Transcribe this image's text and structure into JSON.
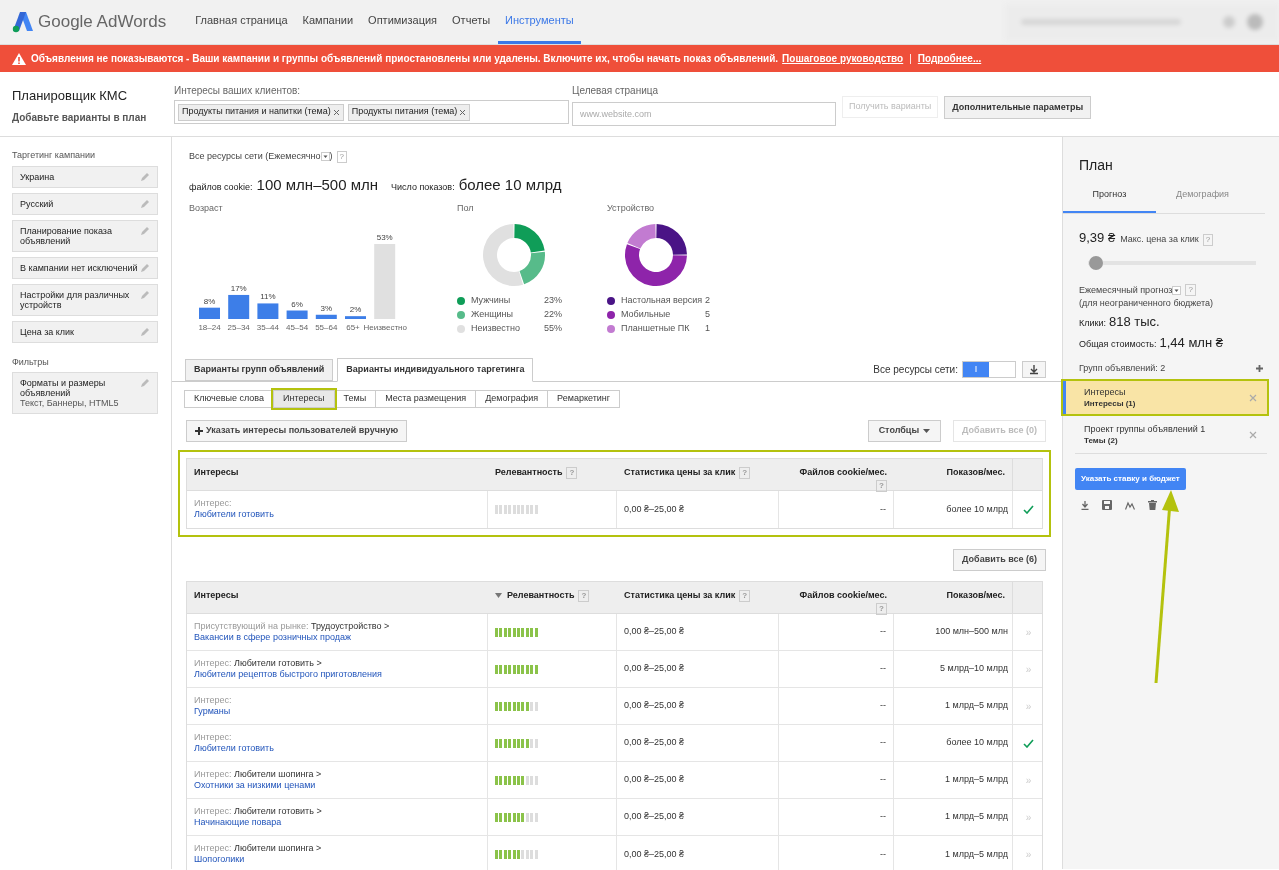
{
  "header": {
    "logo_text": "Google AdWords",
    "nav": [
      {
        "label": "Главная страница",
        "selected": false
      },
      {
        "label": "Кампании",
        "selected": false
      },
      {
        "label": "Оптимизация",
        "selected": false
      },
      {
        "label": "Отчеты",
        "selected": false
      },
      {
        "label": "Инструменты",
        "selected": true
      }
    ]
  },
  "banner": {
    "message": "Объявления не показываются - Ваши кампании и группы объявлений приостановлены или удалены. Включите их, чтобы начать показ объявлений.",
    "links": [
      "Пошаговое руководство",
      "Подробнее..."
    ],
    "separator": "|"
  },
  "planner": {
    "title": "Планировщик КМС",
    "subtitle": "Добавьте варианты в план"
  },
  "interests_input": {
    "label": "Интересы ваших клиентов:",
    "chips": [
      "Продукты питания и напитки (тема)",
      "Продукты питания (тема)"
    ]
  },
  "landing_page": {
    "label": "Целевая страница",
    "placeholder": "www.website.com"
  },
  "get_ideas_button": {
    "label": "Получить варианты",
    "disabled": true
  },
  "advanced_button": {
    "label": "Дополнительные параметры",
    "disabled": false
  },
  "sidebar": {
    "targeting_title": "Таргетинг кампании",
    "targeting_items": [
      {
        "title": "Украина"
      },
      {
        "title": "Русский"
      },
      {
        "title": "Планирование показа объявлений"
      },
      {
        "title": "В кампании нет исключений"
      },
      {
        "title": "Настройки для различных устройств"
      },
      {
        "title": "Цена за клик"
      }
    ],
    "filters_title": "Фильтры",
    "filter_items": [
      {
        "title": "Форматы и размеры объявлений",
        "detail": "Текст, Баннеры, HTML5"
      }
    ]
  },
  "summary": {
    "network": "Все ресурсы сети (Ежемесячно",
    "network_end": ")",
    "help": "?",
    "cookies_label": "файлов cookie:",
    "cookies_value": "100 млн–500 млн",
    "impressions_label": "Число показов:",
    "impressions_value": "более 10 млрд"
  },
  "age": {
    "title": "Возраст",
    "chart_data": {
      "type": "bar",
      "categories": [
        "18–24",
        "25–34",
        "35–44",
        "45–54",
        "55–64",
        "65+",
        "Неизвестно"
      ],
      "values": [
        8,
        17,
        11,
        6,
        3,
        2,
        53
      ],
      "colors": [
        "#3d7ee8",
        "#3d7ee8",
        "#3d7ee8",
        "#3d7ee8",
        "#3d7ee8",
        "#3d7ee8",
        "#e0e0e0"
      ],
      "data_labels": true,
      "value_labels": [
        "8%",
        "17%",
        "11%",
        "6%",
        "3%",
        "2%",
        "53%"
      ]
    }
  },
  "gender": {
    "title": "Пол",
    "chart_data": {
      "type": "donut",
      "values": [
        23,
        22,
        55
      ]
    },
    "legend": [
      {
        "label": "Мужчины",
        "value": "23%",
        "color": "#0f9d58"
      },
      {
        "label": "Женщины",
        "value": "22%",
        "color": "#57bb8a"
      },
      {
        "label": "Неизвестно",
        "value": "55%",
        "color": "#e0e0e0"
      }
    ]
  },
  "device": {
    "title": "Устройство",
    "legend": [
      {
        "label": "Настольная версия",
        "value": "2",
        "color": "#4a1486"
      },
      {
        "label": "Мобильные",
        "value": "5",
        "color": "#8e24aa"
      },
      {
        "label": "Планшетные ПК",
        "value": "1",
        "color": "#c27bd1"
      }
    ]
  },
  "idea_tabs": [
    {
      "label": "Варианты групп объявлений",
      "selected": false
    },
    {
      "label": "Варианты индивидуального таргетинга",
      "selected": true
    }
  ],
  "network_toggle": {
    "label": "Все ресурсы сети:",
    "on": true,
    "on_glyph": "I"
  },
  "subtabs": [
    {
      "label": "Ключевые слова",
      "selected": false,
      "highlighted": false
    },
    {
      "label": "Интересы",
      "selected": true,
      "highlighted": true
    },
    {
      "label": "Темы",
      "selected": false,
      "highlighted": false
    },
    {
      "label": "Места размещения",
      "selected": false,
      "highlighted": false
    },
    {
      "label": "Демография",
      "selected": false,
      "highlighted": false
    },
    {
      "label": "Ремаркетинг",
      "selected": false,
      "highlighted": false
    }
  ],
  "manual_button": "Указать интересы пользователей вручную",
  "columns_button": "Столбцы",
  "add_all_top": {
    "label": "Добавить все (0)",
    "disabled": true
  },
  "selected_table": {
    "highlighted": true,
    "columns": [
      {
        "label": "Интересы",
        "sorted": false
      },
      {
        "label": "Релевантность",
        "help": "?",
        "sorted": false
      },
      {
        "label": "Статистика цены за клик",
        "help": "?",
        "sorted": false
      },
      {
        "label": "Файлов cookie/мес.",
        "help": "?",
        "sorted": false
      },
      {
        "label": "Показов/мес.",
        "sorted": false
      }
    ],
    "rows": [
      {
        "prefix": "Интерес:",
        "name": "Любители готовить",
        "level": 0,
        "cpc": "0,00 ₴–25,00 ₴",
        "cookies": "--",
        "impressions": "более 10 млрд",
        "added": true
      }
    ]
  },
  "add_all_bottom": {
    "label": "Добавить все (6)",
    "disabled": false
  },
  "ideas_table": {
    "columns": [
      {
        "label": "Интересы",
        "sorted": false
      },
      {
        "label": "Релевантность",
        "help": "?",
        "sorted": true
      },
      {
        "label": "Статистика цены за клик",
        "help": "?",
        "sorted": false
      },
      {
        "label": "Файлов cookie/мес.",
        "help": "?",
        "sorted": false
      },
      {
        "label": "Показов/мес.",
        "sorted": false
      }
    ],
    "rows": [
      {
        "prefix": "Присутствующий на рынке:",
        "path": "Трудоустройство >",
        "name": "Вакансии в сфере розничных продаж",
        "level": 1,
        "cpc": "0,00 ₴–25,00 ₴",
        "cookies": "--",
        "impressions": "100 млн–500 млн",
        "added": false,
        "add_glyph": "»"
      },
      {
        "prefix": "Интерес:",
        "path": "Любители готовить >",
        "name": "Любители рецептов быстрого приготовления",
        "level": 1,
        "cpc": "0,00 ₴–25,00 ₴",
        "cookies": "--",
        "impressions": "5 млрд–10 млрд",
        "added": false,
        "add_glyph": "»"
      },
      {
        "prefix": "Интерес:",
        "name": "Гурманы",
        "level": 0.8,
        "cpc": "0,00 ₴–25,00 ₴",
        "cookies": "--",
        "impressions": "1 млрд–5 млрд",
        "added": false,
        "add_glyph": "»"
      },
      {
        "prefix": "Интерес:",
        "name": "Любители готовить",
        "level": 0.8,
        "cpc": "0,00 ₴–25,00 ₴",
        "cookies": "--",
        "impressions": "более 10 млрд",
        "added": true
      },
      {
        "prefix": "Интерес:",
        "path": "Любители шопинга >",
        "name": "Охотники за низкими ценами",
        "level": 0.7,
        "cpc": "0,00 ₴–25,00 ₴",
        "cookies": "--",
        "impressions": "1 млрд–5 млрд",
        "added": false,
        "add_glyph": "»"
      },
      {
        "prefix": "Интерес:",
        "path": "Любители готовить >",
        "name": "Начинающие повара",
        "level": 0.7,
        "cpc": "0,00 ₴–25,00 ₴",
        "cookies": "--",
        "impressions": "1 млрд–5 млрд",
        "added": false,
        "add_glyph": "»"
      },
      {
        "prefix": "Интерес:",
        "path": "Любители шопинга >",
        "name": "Шопоголики",
        "level": 0.6,
        "cpc": "0,00 ₴–25,00 ₴",
        "cookies": "--",
        "impressions": "1 млрд–5 млрд",
        "added": false,
        "add_glyph": "»"
      }
    ]
  },
  "plan": {
    "title": "План",
    "tabs": [
      {
        "label": "Прогноз",
        "selected": true
      },
      {
        "label": "Демография",
        "selected": false
      }
    ],
    "bid": "9,39 ₴",
    "bid_label": "Макс. цена за клик",
    "bid_help": "?",
    "slider": {
      "level": 0.05
    },
    "forecast_label": "Ежемесячный прогноз",
    "forecast_help": "?",
    "forecast_note": "(для неограниченного бюджета)",
    "clicks_label": "Клики:",
    "clicks_value": "818 тыс.",
    "cost_label": "Общая стоимость:",
    "cost_value": "1,44 млн ₴",
    "groups_label": "Групп объявлений: 2",
    "groups": [
      {
        "title": "Интересы",
        "subtitle": "Интересы (1)",
        "selected": true,
        "highlighted": true
      },
      {
        "title": "Проект группы объявлений 1",
        "subtitle": "Темы (2)",
        "selected": false,
        "highlighted": false
      }
    ],
    "submit": "Указать ставку и бюджет"
  }
}
